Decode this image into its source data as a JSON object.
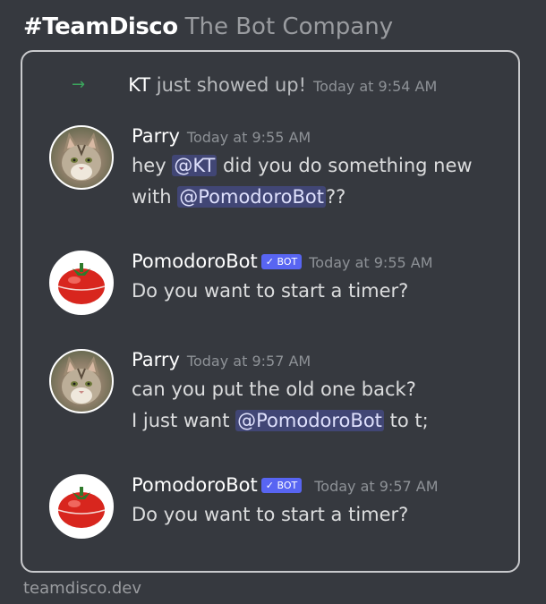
{
  "header": {
    "hashtag": "#TeamDisco",
    "company": "The Bot Company"
  },
  "join_event": {
    "arrow_icon": "arrow-right-icon",
    "user": "KT",
    "text": "just showed up!",
    "timestamp": "Today at 9:54 AM"
  },
  "messages": [
    {
      "author": "Parry",
      "timestamp": "Today at 9:55 AM",
      "line1_before": "hey ",
      "line1_mention": "@KT",
      "line1_after": " did you do something new",
      "line2_before": "with ",
      "line2_mention": "@PomodoroBot",
      "line2_after": "??"
    },
    {
      "author": "PomodoroBot",
      "badge": "✓ BOT",
      "timestamp": "Today at 9:55 AM",
      "text": "Do you want to start a timer?"
    },
    {
      "author": "Parry",
      "timestamp": "Today at 9:57 AM",
      "line1": "can you put the old one back?",
      "line2_before": "I just want ",
      "line2_mention": "@PomodoroBot",
      "line2_after": " to t;"
    },
    {
      "author": "PomodoroBot",
      "badge": "✓ BOT",
      "timestamp": "Today at 9:57 AM",
      "text": "Do you want to start a timer?"
    }
  ],
  "footer": "teamdisco.dev",
  "colors": {
    "background": "#36393f",
    "mention_bg": "#414675",
    "bot_badge": "#5865f2",
    "join_arrow": "#3ba55d"
  }
}
